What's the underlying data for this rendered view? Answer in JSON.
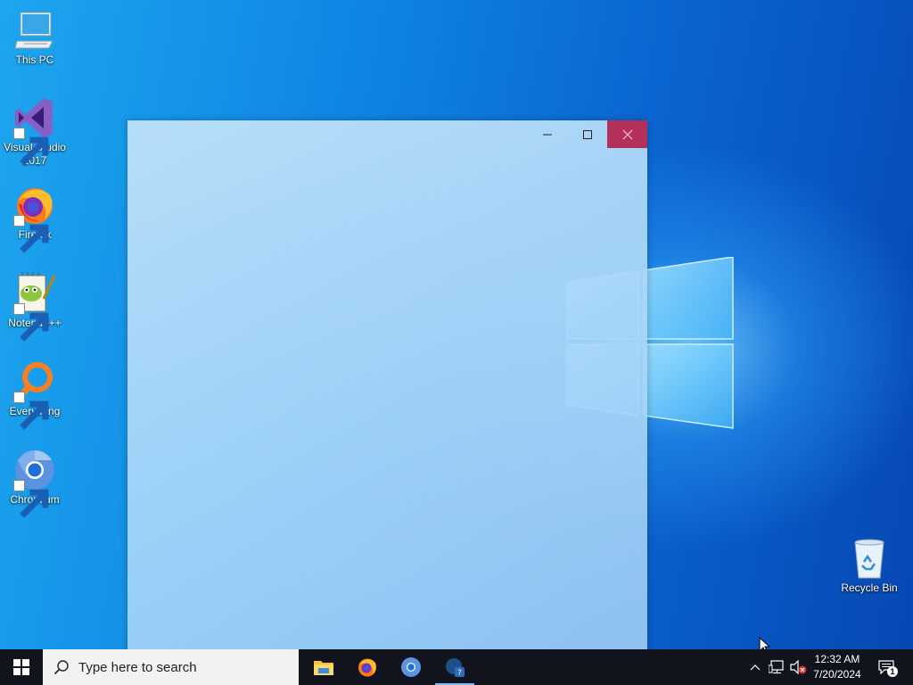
{
  "desktop": {
    "icons": [
      {
        "label": "This PC",
        "icon": "computer-icon"
      },
      {
        "label": "Visual Studio\n2017",
        "line1": "Visual Studio",
        "line2": "2017",
        "icon": "visual-studio-icon"
      },
      {
        "label": "Firefox",
        "icon": "firefox-icon"
      },
      {
        "label": "Notepad++",
        "icon": "notepad-plus-plus-icon"
      },
      {
        "label": "Everything",
        "icon": "everything-search-icon"
      },
      {
        "label": "Chromium",
        "icon": "chromium-icon"
      },
      {
        "label": "Recycle Bin",
        "icon": "recycle-bin-icon"
      }
    ]
  },
  "window": {
    "controls": [
      "minimize",
      "maximize",
      "close"
    ],
    "close_color": "#b2305a"
  },
  "taskbar": {
    "search_placeholder": "Type here to search",
    "apps": [
      "file-explorer-icon",
      "firefox-icon",
      "chromium-icon",
      "unknown-app-icon"
    ],
    "clock": {
      "time": "12:32 AM",
      "date": "7/20/2024"
    },
    "notifications_count": "1"
  },
  "colors": {
    "taskbar": "#11141c",
    "desktop_accent": "#0f86e4"
  }
}
